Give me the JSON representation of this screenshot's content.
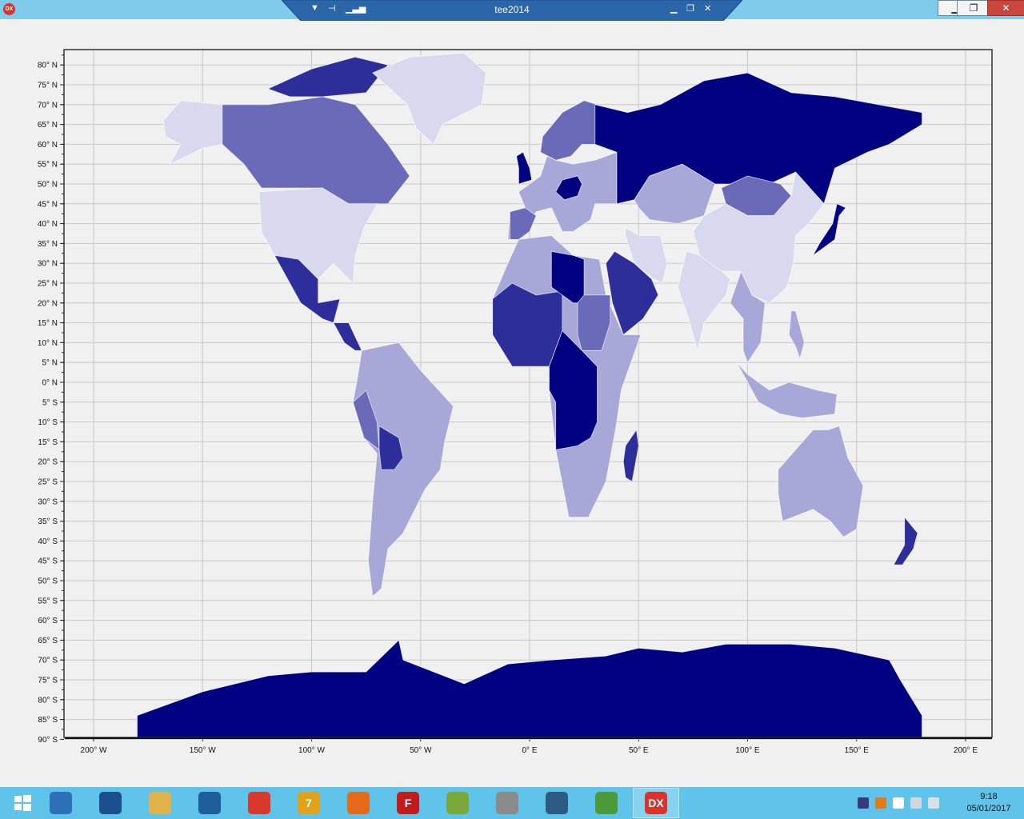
{
  "window": {
    "title": "tee2014",
    "app_icon": "DX"
  },
  "map": {
    "lat_ticks": [
      "80° N",
      "75° N",
      "70° N",
      "65° N",
      "60° N",
      "55° N",
      "50° N",
      "45° N",
      "40° N",
      "35° N",
      "30° N",
      "25° N",
      "20° N",
      "15° N",
      "10° N",
      "5° N",
      "0° N",
      "5° S",
      "10° S",
      "15° S",
      "20° S",
      "25° S",
      "30° S",
      "35° S",
      "40° S",
      "45° S",
      "50° S",
      "55° S",
      "60° S",
      "65° S",
      "70° S",
      "75° S",
      "80° S",
      "85° S",
      "90° S"
    ],
    "lon_ticks": [
      "200° W",
      "150° W",
      "100° W",
      "50° W",
      "0° E",
      "50° E",
      "100° E",
      "150° E",
      "200° E"
    ],
    "colors": {
      "darkest": "#000080",
      "dark": "#2e2e9a",
      "medium": "#6a6ab8",
      "light": "#a8a8d8",
      "lightest": "#d8d8ee",
      "background": "#f0f0f0",
      "grid": "#c8c8c8"
    }
  },
  "taskbar": {
    "items": [
      {
        "name": "windows-start-icon",
        "label": "",
        "color": "#5fc3ea"
      },
      {
        "name": "server-manager-icon",
        "label": "",
        "color": "#2d6fb8"
      },
      {
        "name": "powershell-icon",
        "label": "",
        "color": "#1c4f8f"
      },
      {
        "name": "file-explorer-icon",
        "label": "",
        "color": "#e0b24a"
      },
      {
        "name": "delta-app-icon",
        "label": "",
        "color": "#1f5d9a"
      },
      {
        "name": "chrome-icon",
        "label": "",
        "color": "#d9382d"
      },
      {
        "name": "seven-app-icon",
        "label": "7",
        "color": "#e0a21a"
      },
      {
        "name": "firefox-icon",
        "label": "",
        "color": "#e66a1a"
      },
      {
        "name": "filezilla-icon",
        "label": "F",
        "color": "#c21b1b"
      },
      {
        "name": "sync-app-icon",
        "label": "",
        "color": "#7aa83a"
      },
      {
        "name": "mouse-app-icon",
        "label": "",
        "color": "#8a8a8a"
      },
      {
        "name": "tree-app-icon",
        "label": "",
        "color": "#2c5a82"
      },
      {
        "name": "chart-editor-icon",
        "label": "",
        "color": "#4a9a3a"
      },
      {
        "name": "dx-app-icon",
        "label": "DX",
        "color": "#d9342b"
      }
    ],
    "clock": {
      "time": "9:18",
      "date": "05/01/2017"
    }
  }
}
